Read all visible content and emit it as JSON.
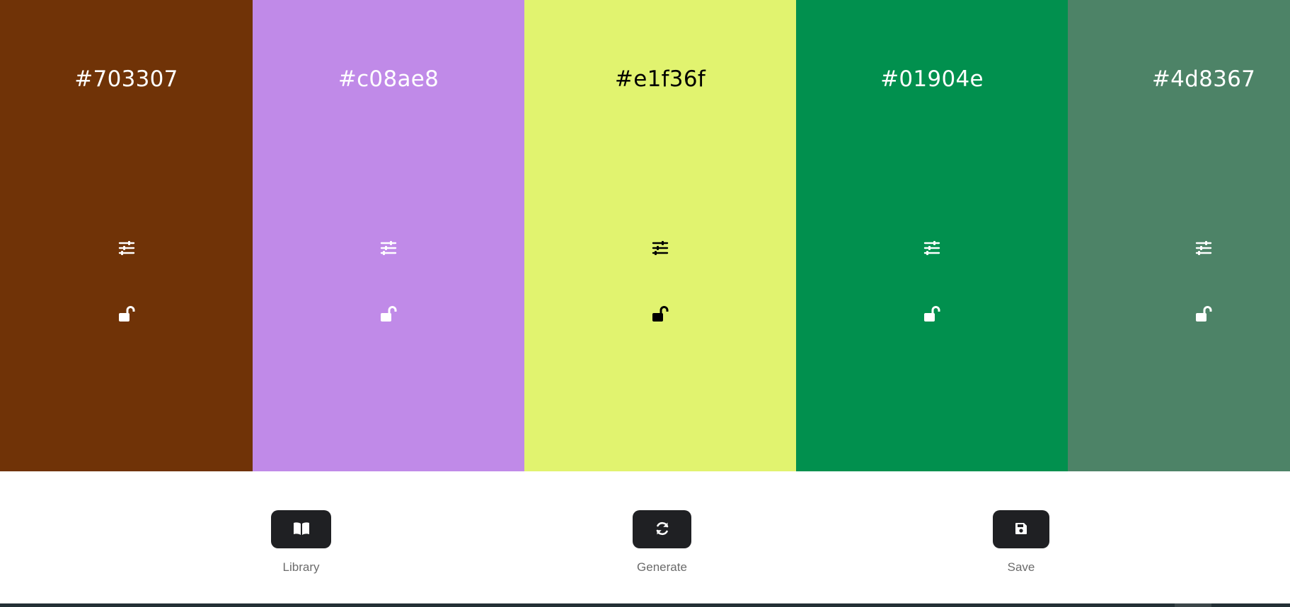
{
  "palette": {
    "colors": [
      {
        "hex": "#703307",
        "text_color": "#ffffff"
      },
      {
        "hex": "#c08ae8",
        "text_color": "#ffffff"
      },
      {
        "hex": "#e1f36f",
        "text_color": "#000000"
      },
      {
        "hex": "#01904e",
        "text_color": "#ffffff"
      },
      {
        "hex": "#4d8367",
        "text_color": "#ffffff"
      }
    ],
    "icons": {
      "adjust": "sliders-icon",
      "lock": "unlock-icon"
    }
  },
  "toolbar": {
    "library_label": "Library",
    "generate_label": "Generate",
    "save_label": "Save",
    "button_color": "#1f2023",
    "icons": {
      "library": "book-icon",
      "generate": "refresh-icon",
      "save": "floppy-disk-icon"
    }
  }
}
